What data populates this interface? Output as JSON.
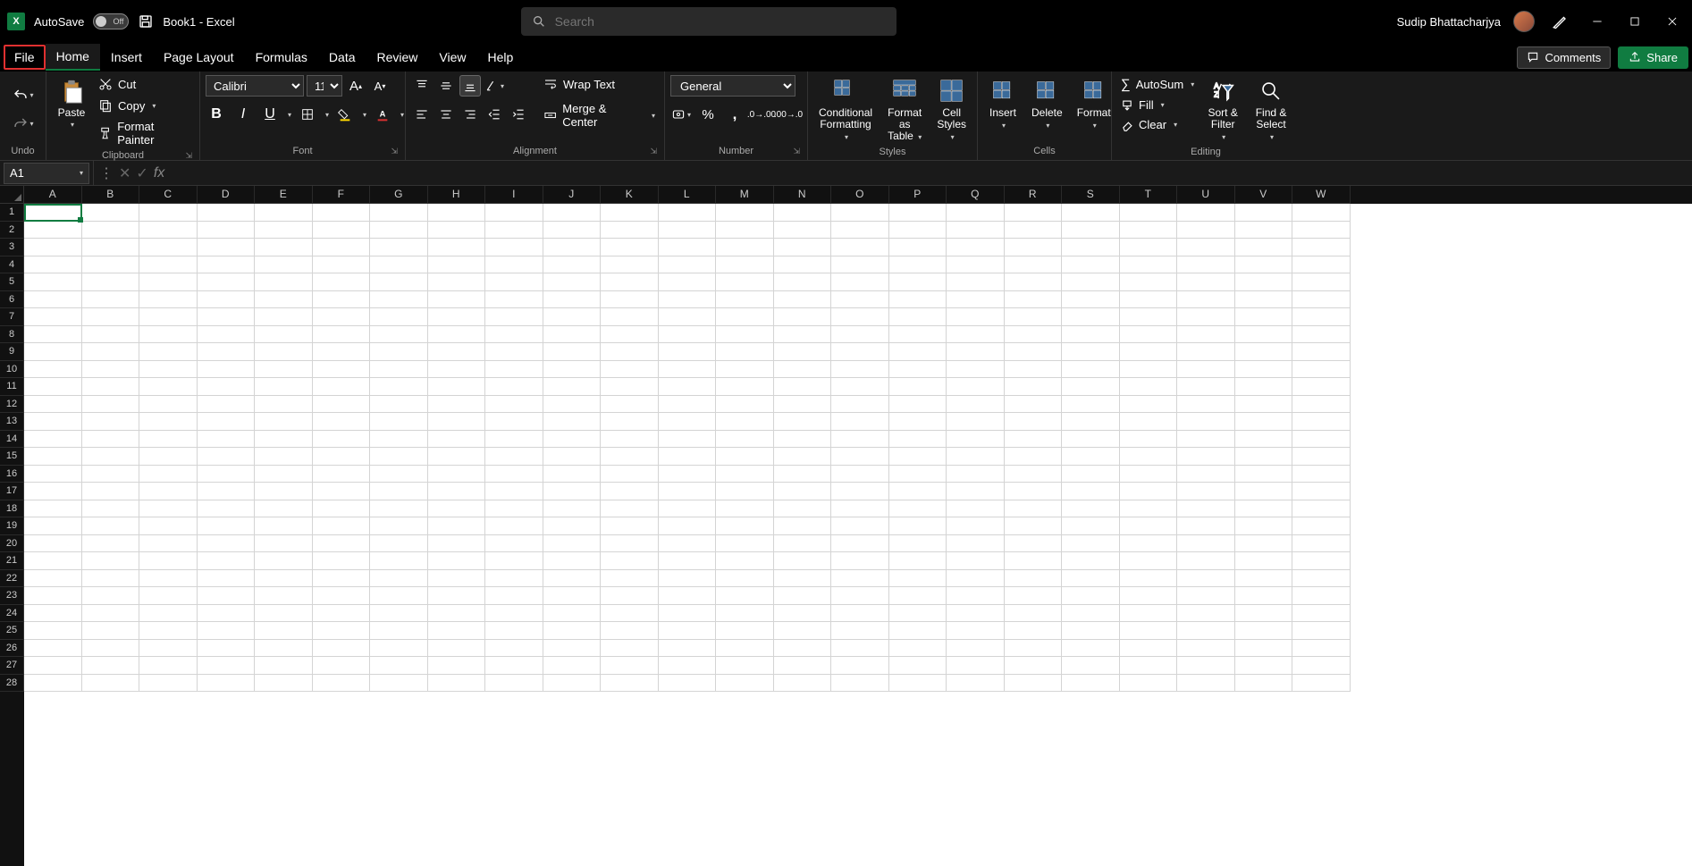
{
  "titlebar": {
    "autosave_label": "AutoSave",
    "autosave_state": "Off",
    "document_title": "Book1 - Excel",
    "search_placeholder": "Search",
    "username": "Sudip Bhattacharjya"
  },
  "tabs": {
    "file": "File",
    "home": "Home",
    "insert": "Insert",
    "page_layout": "Page Layout",
    "formulas": "Formulas",
    "data": "Data",
    "review": "Review",
    "view": "View",
    "help": "Help",
    "comments": "Comments",
    "share": "Share"
  },
  "ribbon": {
    "undo_group": "Undo",
    "clipboard": {
      "paste": "Paste",
      "cut": "Cut",
      "copy": "Copy",
      "format_painter": "Format Painter",
      "label": "Clipboard"
    },
    "font": {
      "name": "Calibri",
      "size": "11",
      "label": "Font"
    },
    "alignment": {
      "wrap": "Wrap Text",
      "merge": "Merge & Center",
      "label": "Alignment"
    },
    "number": {
      "format": "General",
      "label": "Number"
    },
    "styles": {
      "conditional": "Conditional Formatting",
      "format_table": "Format as Table",
      "cell_styles": "Cell Styles",
      "label": "Styles"
    },
    "cells": {
      "insert": "Insert",
      "delete": "Delete",
      "format": "Format",
      "label": "Cells"
    },
    "editing": {
      "autosum": "AutoSum",
      "fill": "Fill",
      "clear": "Clear",
      "sort": "Sort & Filter",
      "find": "Find & Select",
      "label": "Editing"
    }
  },
  "formulabar": {
    "namebox": "A1",
    "formula": ""
  },
  "grid": {
    "columns": [
      "A",
      "B",
      "C",
      "D",
      "E",
      "F",
      "G",
      "H",
      "I",
      "J",
      "K",
      "L",
      "M",
      "N",
      "O",
      "P",
      "Q",
      "R",
      "S",
      "T",
      "U",
      "V",
      "W"
    ],
    "rows": [
      1,
      2,
      3,
      4,
      5,
      6,
      7,
      8,
      9,
      10,
      11,
      12,
      13,
      14,
      15,
      16,
      17,
      18,
      19,
      20,
      21,
      22,
      23,
      24,
      25,
      26,
      27,
      28
    ],
    "selected_cell": "A1"
  }
}
